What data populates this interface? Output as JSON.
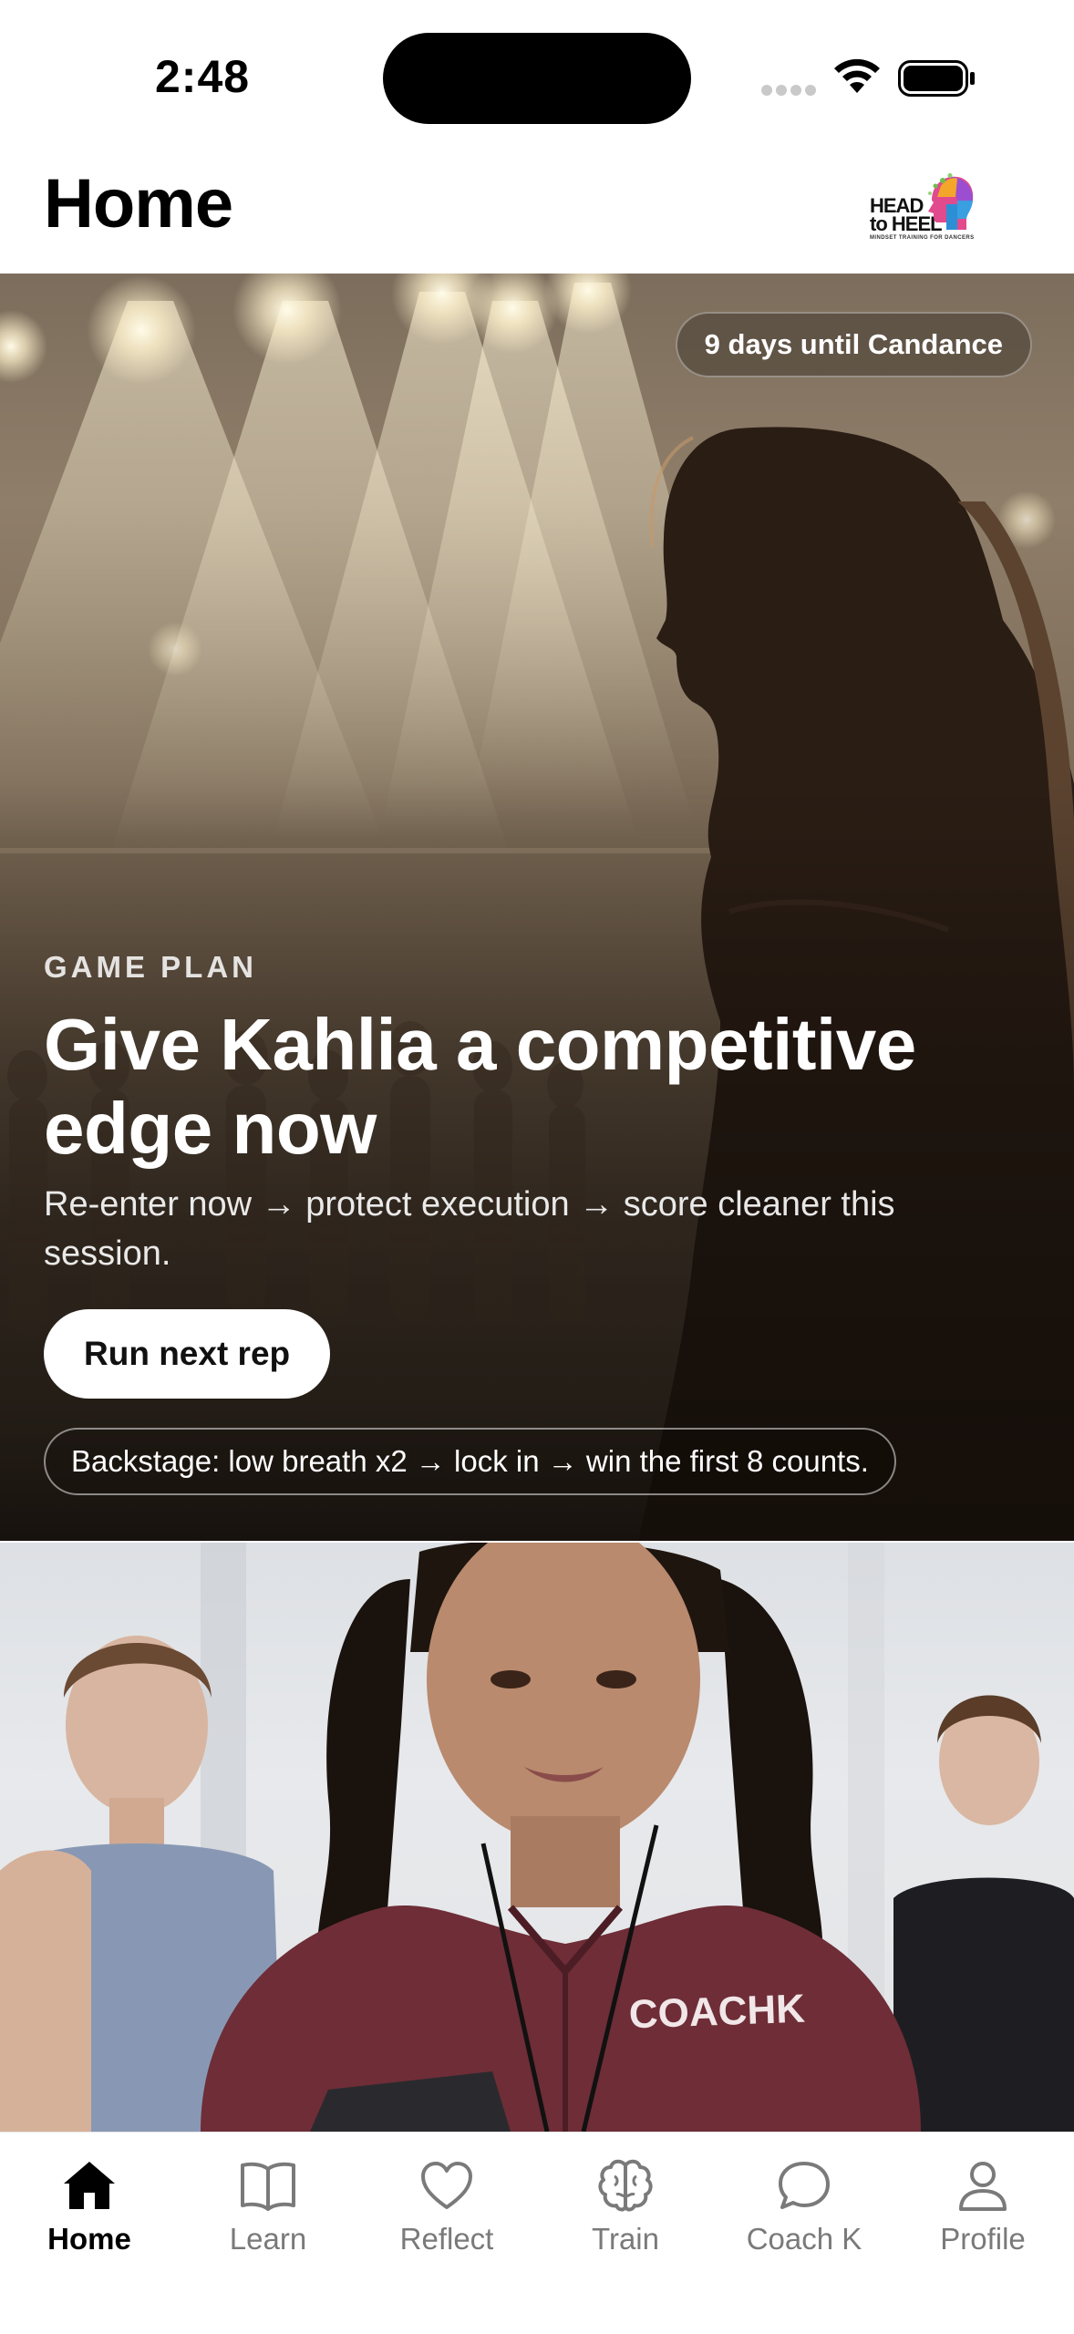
{
  "status_bar": {
    "time": "2:48"
  },
  "header": {
    "title": "Home",
    "logo": {
      "text_line1": "HEAD",
      "text_line2": "to HEEL",
      "tagline": "MINDSET TRAINING FOR DANCERS"
    }
  },
  "hero": {
    "countdown": "9 days until Candance",
    "eyebrow": "GAME PLAN",
    "headline": "Give Kahlia a competitive edge now",
    "subtitle": "Re-enter now → protect execution → score cleaner this session.",
    "cta_label": "Run next rep",
    "tip": "Backstage: low breath x2 → lock in → win the first 8 counts."
  },
  "coach_card": {
    "jacket_text": "COACHK"
  },
  "tab_bar": {
    "active": "Home",
    "items": [
      {
        "label": "Home",
        "icon": "home-icon"
      },
      {
        "label": "Learn",
        "icon": "book-icon"
      },
      {
        "label": "Reflect",
        "icon": "heart-icon"
      },
      {
        "label": "Train",
        "icon": "brain-icon"
      },
      {
        "label": "Coach K",
        "icon": "chat-bubble-icon"
      },
      {
        "label": "Profile",
        "icon": "person-icon"
      }
    ]
  },
  "colors": {
    "text_primary": "#000000",
    "tab_inactive": "#7a7a7a",
    "cta_background": "#ffffff"
  }
}
